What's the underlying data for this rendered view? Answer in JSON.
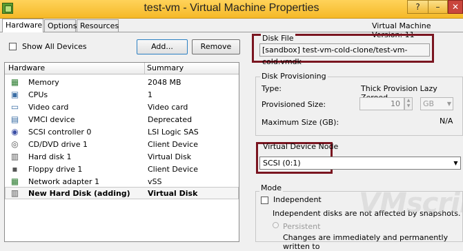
{
  "window": {
    "title": "test-vm - Virtual Machine Properties",
    "help_label": "?",
    "minimize_label": "–",
    "close_label": "✕"
  },
  "tabs": [
    {
      "label": "Hardware",
      "active": true
    },
    {
      "label": "Options",
      "active": false
    },
    {
      "label": "Resources",
      "active": false
    }
  ],
  "vm_version": "Virtual Machine Version: 11",
  "left": {
    "show_all_devices_label": "Show All Devices",
    "add_label": "Add...",
    "remove_label": "Remove",
    "columns": [
      "Hardware",
      "Summary"
    ],
    "rows": [
      {
        "icon": "memory-icon",
        "name": "Memory",
        "summary": "2048 MB"
      },
      {
        "icon": "cpu-icon",
        "name": "CPUs",
        "summary": "1"
      },
      {
        "icon": "video-card-icon",
        "name": "Video card",
        "summary": "Video card"
      },
      {
        "icon": "vmci-device-icon",
        "name": "VMCI device",
        "summary": "Deprecated"
      },
      {
        "icon": "scsi-controller-icon",
        "name": "SCSI controller 0",
        "summary": "LSI Logic SAS"
      },
      {
        "icon": "cd-dvd-icon",
        "name": "CD/DVD drive 1",
        "summary": "Client Device"
      },
      {
        "icon": "hard-disk-icon",
        "name": "Hard disk 1",
        "summary": "Virtual Disk"
      },
      {
        "icon": "floppy-icon",
        "name": "Floppy drive 1",
        "summary": "Client Device"
      },
      {
        "icon": "network-adapter-icon",
        "name": "Network adapter 1",
        "summary": "vSS"
      },
      {
        "icon": "hard-disk-icon",
        "name": "New Hard Disk (adding)",
        "summary": "Virtual Disk",
        "selected": true
      }
    ]
  },
  "disk_file": {
    "legend": "Disk File",
    "value": "[sandbox] test-vm-cold-clone/test-vm-cold.vmdk"
  },
  "disk_provisioning": {
    "legend": "Disk Provisioning",
    "type_label": "Type:",
    "type_value": "Thick Provision Lazy Zeroed",
    "provisioned_label": "Provisioned Size:",
    "provisioned_value": "10",
    "provisioned_unit": "GB",
    "max_label": "Maximum Size (GB):",
    "max_value": "N/A"
  },
  "virtual_device_node": {
    "legend": "Virtual Device Node",
    "selected": "SCSI (0:1)"
  },
  "mode": {
    "legend": "Mode",
    "independent_label": "Independent",
    "independent_desc": "Independent disks are not affected by snapshots.",
    "persistent_label": "Persistent",
    "persistent_desc": "Changes are immediately and permanently written to"
  },
  "watermark": "VMscribble"
}
